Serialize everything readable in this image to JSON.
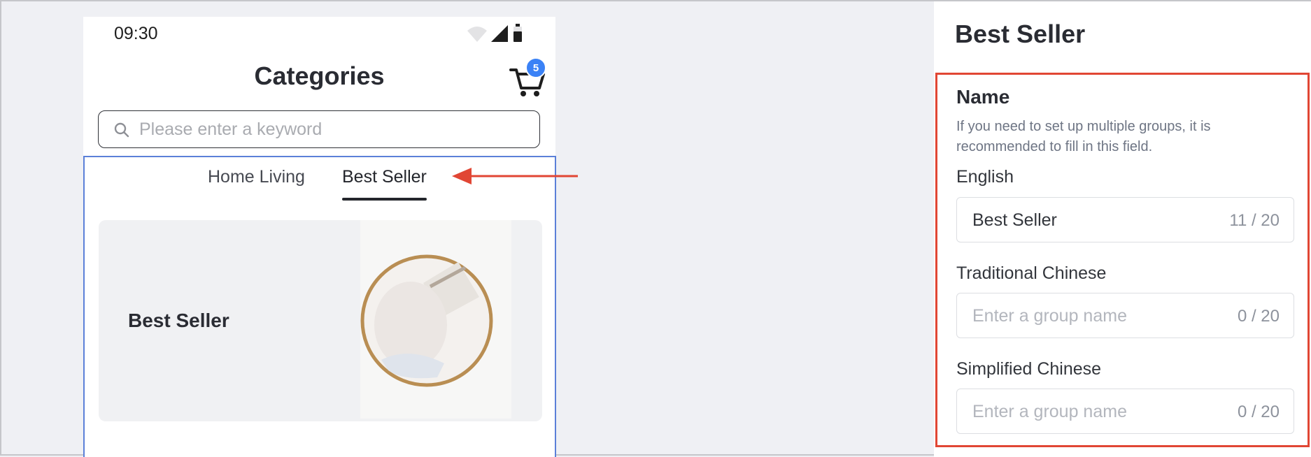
{
  "phone": {
    "status_time": "09:30",
    "title": "Categories",
    "cart_count": "5",
    "search_placeholder": "Please enter a keyword",
    "tabs": [
      {
        "label": "Home Living",
        "active": false
      },
      {
        "label": "Best Seller",
        "active": true
      }
    ],
    "card": {
      "title": "Best Seller"
    }
  },
  "panel": {
    "title": "Best Seller",
    "section_title": "Name",
    "section_desc": "If you need to set up multiple groups, it is recommended to fill in this field.",
    "fields": [
      {
        "label": "English",
        "value": "Best Seller",
        "placeholder": "",
        "counter": "11 / 20"
      },
      {
        "label": "Traditional Chinese",
        "value": "",
        "placeholder": "Enter a group name",
        "counter": "0 / 20"
      },
      {
        "label": "Simplified Chinese",
        "value": "",
        "placeholder": "Enter a group name",
        "counter": "0 / 20"
      }
    ]
  },
  "colors": {
    "highlight_red": "#e14634",
    "selection_blue": "#5b80d8",
    "badge_blue": "#3b82f6"
  }
}
